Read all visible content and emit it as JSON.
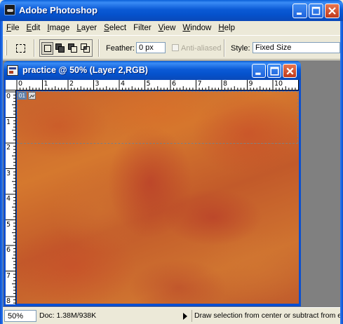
{
  "app": {
    "title": "Adobe Photoshop"
  },
  "menu": [
    {
      "key": "F",
      "rest": "ile"
    },
    {
      "key": "E",
      "rest": "dit"
    },
    {
      "key": "I",
      "rest": "mage"
    },
    {
      "key": "L",
      "rest": "ayer"
    },
    {
      "key": "S",
      "rest": "elect"
    },
    {
      "key": "",
      "rest": "Filter"
    },
    {
      "key": "V",
      "rest": "iew"
    },
    {
      "key": "W",
      "rest": "indow"
    },
    {
      "key": "H",
      "rest": "elp"
    }
  ],
  "options": {
    "feather_label": "Feather:",
    "feather_value": "0 px",
    "antialias_label": "Anti-aliased",
    "style_label": "Style:",
    "style_value": "Fixed Size"
  },
  "document": {
    "title": "practice @ 50% (Layer 2,RGB)",
    "slice_number": "01",
    "ruler_h": [
      "0",
      "1",
      "2",
      "3",
      "4",
      "5",
      "6",
      "7",
      "8",
      "9",
      "10",
      "1"
    ],
    "ruler_v": [
      "0",
      "1",
      "2",
      "3",
      "4",
      "5",
      "6",
      "7",
      "8"
    ]
  },
  "status": {
    "zoom": "50%",
    "doc_size": "Doc: 1.38M/938K",
    "message": "Draw selection from center or subtract from e"
  },
  "colors": {
    "title_blue": "#0552cc",
    "canvas_orange": "#c7622c",
    "close_red": "#c0391c"
  }
}
